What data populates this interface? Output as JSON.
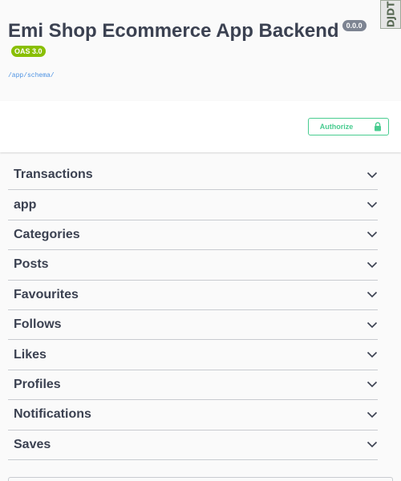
{
  "info": {
    "title": "Emi Shop Ecommerce App Backend",
    "version": "0.0.0",
    "oas_version": "OAS 3.0",
    "spec_url": "/app/schema/"
  },
  "side_tag": {
    "text": "DJDT"
  },
  "scheme": {
    "authorize_label": "Authorize"
  },
  "tags": [
    {
      "label": "Transactions"
    },
    {
      "label": "app"
    },
    {
      "label": "Categories"
    },
    {
      "label": "Posts"
    },
    {
      "label": "Favourites"
    },
    {
      "label": "Follows"
    },
    {
      "label": "Likes"
    },
    {
      "label": "Profiles"
    },
    {
      "label": "Notifications"
    },
    {
      "label": "Saves"
    }
  ],
  "colors": {
    "accent_green": "#49cc90",
    "oas_badge": "#89bf04",
    "version_badge": "#7d8492",
    "text": "#3b4151",
    "link": "#4990e2"
  },
  "icons": {
    "authorize": "lock-icon",
    "tag_toggle": "chevron-down-icon"
  }
}
